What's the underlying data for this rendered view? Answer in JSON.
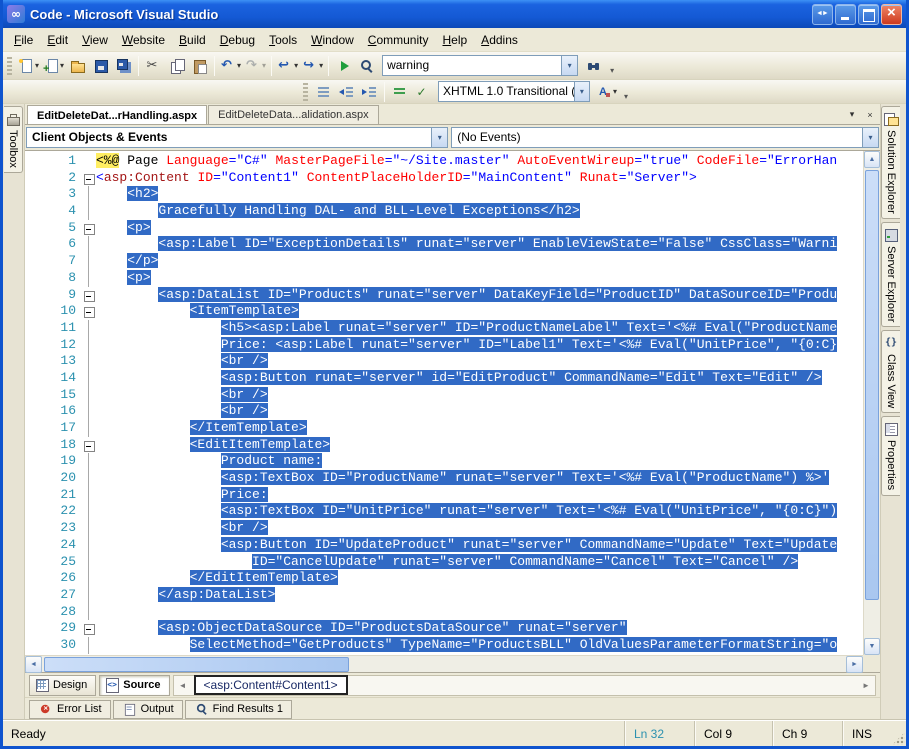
{
  "window": {
    "title": "Code - Microsoft Visual Studio",
    "app_initial": "∞",
    "controls": [
      {
        "name": "dock-arrows"
      },
      {
        "name": "minimize"
      },
      {
        "name": "maximize"
      },
      {
        "name": "close"
      }
    ]
  },
  "glyphs": {
    "dropdown": "▾",
    "close": "×",
    "scroll_left": "◄",
    "scroll_right": "►",
    "scroll_up": "▲",
    "scroll_down": "▼",
    "nav_back": "◄",
    "nav_forward": "►"
  },
  "menu": [
    "File",
    "Edit",
    "View",
    "Website",
    "Build",
    "Debug",
    "Tools",
    "Window",
    "Community",
    "Help",
    "Addins"
  ],
  "toolbar_standard": {
    "buttons": [
      {
        "icon": "new-website",
        "dropdown": true
      },
      {
        "icon": "add-item",
        "dropdown": true
      },
      {
        "icon": "open-file"
      },
      {
        "icon": "save"
      },
      {
        "icon": "save-all"
      },
      {
        "sep": true
      },
      {
        "icon": "cut"
      },
      {
        "icon": "copy"
      },
      {
        "icon": "paste"
      },
      {
        "sep": true
      },
      {
        "icon": "undo",
        "dropdown": true
      },
      {
        "icon": "redo",
        "dropdown": true,
        "disabled": true
      },
      {
        "sep": true
      },
      {
        "icon": "nav-backward",
        "dropdown": true
      },
      {
        "icon": "nav-forward",
        "dropdown": true
      },
      {
        "sep": true
      },
      {
        "icon": "start-debug"
      },
      {
        "icon": "find-in-files"
      },
      {
        "combo": "warning",
        "name": "find-combo"
      },
      {
        "icon": "find-symbol"
      },
      {
        "overflow": true
      }
    ]
  },
  "toolbar_html_source": {
    "buttons": [
      {
        "icon": "format-document"
      },
      {
        "icon": "decrease-indent"
      },
      {
        "icon": "increase-indent"
      },
      {
        "sep": true
      },
      {
        "icon": "comment"
      },
      {
        "icon": "task-list"
      },
      {
        "combo": "XHTML 1.0 Transitional (",
        "name": "schema-combo"
      },
      {
        "icon": "style-application",
        "dropdown": true
      },
      {
        "overflow": true
      }
    ]
  },
  "document_tabs": [
    {
      "label": "EditDeleteDat...rHandling.aspx",
      "active": true
    },
    {
      "label": "EditDeleteData...alidation.aspx",
      "active": false
    }
  ],
  "navigation_bar": {
    "left": "Client Objects & Events",
    "right": "(No Events)"
  },
  "editor": {
    "lines": [
      {
        "n": 1,
        "fold": "",
        "tokens": [
          [
            "dir",
            "<%@"
          ],
          [
            "pl",
            " Page "
          ],
          [
            "at",
            "Language"
          ],
          [
            "vl",
            "=\"C#\""
          ],
          [
            "pl",
            " "
          ],
          [
            "at",
            "MasterPageFile"
          ],
          [
            "vl",
            "=\"~/Site.master\""
          ],
          [
            "pl",
            " "
          ],
          [
            "at",
            "AutoEventWireup"
          ],
          [
            "vl",
            "=\"true\""
          ],
          [
            "pl",
            " "
          ],
          [
            "at",
            "CodeFile"
          ],
          [
            "vl",
            "=\"ErrorHan"
          ]
        ]
      },
      {
        "n": 2,
        "fold": "box",
        "tokens": [
          [
            "dl",
            "<"
          ],
          [
            "tag",
            "asp:Content"
          ],
          [
            "pl",
            " "
          ],
          [
            "at",
            "ID"
          ],
          [
            "vl",
            "=\"Content1\""
          ],
          [
            "pl",
            " "
          ],
          [
            "at",
            "ContentPlaceHolderID"
          ],
          [
            "vl",
            "=\"MainContent\""
          ],
          [
            "pl",
            " "
          ],
          [
            "at",
            "Runat"
          ],
          [
            "vl",
            "=\"Server\""
          ],
          [
            "dl",
            ">"
          ]
        ]
      },
      {
        "n": 3,
        "fold": "line",
        "indent": "    ",
        "sel": "<h2>"
      },
      {
        "n": 4,
        "fold": "line",
        "indent": "        ",
        "sel": "Gracefully Handling DAL- and BLL-Level Exceptions</h2>"
      },
      {
        "n": 5,
        "fold": "box",
        "indent": "    ",
        "sel": "<p>"
      },
      {
        "n": 6,
        "fold": "line",
        "indent": "        ",
        "sel": "<asp:Label ID=\"ExceptionDetails\" runat=\"server\" EnableViewState=\"False\" CssClass=\"Warni"
      },
      {
        "n": 7,
        "fold": "line",
        "indent": "    ",
        "sel": "</p>"
      },
      {
        "n": 8,
        "fold": "line",
        "indent": "    ",
        "sel": "<p>"
      },
      {
        "n": 9,
        "fold": "box",
        "indent": "        ",
        "sel": "<asp:DataList ID=\"Products\" runat=\"server\" DataKeyField=\"ProductID\" DataSourceID=\"Produ"
      },
      {
        "n": 10,
        "fold": "box",
        "indent": "            ",
        "sel": "<ItemTemplate>"
      },
      {
        "n": 11,
        "fold": "line",
        "indent": "                ",
        "sel": "<h5><asp:Label runat=\"server\" ID=\"ProductNameLabel\" Text='<%# Eval(\"ProductName"
      },
      {
        "n": 12,
        "fold": "line",
        "indent": "                ",
        "sel": "Price: <asp:Label runat=\"server\" ID=\"Label1\" Text='<%# Eval(\"UnitPrice\", \"{0:C}"
      },
      {
        "n": 13,
        "fold": "line",
        "indent": "                ",
        "sel": "<br />"
      },
      {
        "n": 14,
        "fold": "line",
        "indent": "                ",
        "sel": "<asp:Button runat=\"server\" id=\"EditProduct\" CommandName=\"Edit\" Text=\"Edit\" />"
      },
      {
        "n": 15,
        "fold": "line",
        "indent": "                ",
        "sel": "<br />"
      },
      {
        "n": 16,
        "fold": "line",
        "indent": "                ",
        "sel": "<br />"
      },
      {
        "n": 17,
        "fold": "line",
        "indent": "            ",
        "sel": "</ItemTemplate>"
      },
      {
        "n": 18,
        "fold": "box",
        "indent": "            ",
        "sel": "<EditItemTemplate>"
      },
      {
        "n": 19,
        "fold": "line",
        "indent": "                ",
        "sel": "Product name:"
      },
      {
        "n": 20,
        "fold": "line",
        "indent": "                ",
        "sel": "<asp:TextBox ID=\"ProductName\" runat=\"server\" Text='<%# Eval(\"ProductName\") %>'"
      },
      {
        "n": 21,
        "fold": "line",
        "indent": "                ",
        "sel": "Price:"
      },
      {
        "n": 22,
        "fold": "line",
        "indent": "                ",
        "sel": "<asp:TextBox ID=\"UnitPrice\" runat=\"server\" Text='<%# Eval(\"UnitPrice\", \"{0:C}\")"
      },
      {
        "n": 23,
        "fold": "line",
        "indent": "                ",
        "sel": "<br />"
      },
      {
        "n": 24,
        "fold": "line",
        "indent": "                ",
        "sel": "<asp:Button ID=\"UpdateProduct\" runat=\"server\" CommandName=\"Update\" Text=\"Update"
      },
      {
        "n": 25,
        "fold": "line",
        "indent": "                    ",
        "sel": "ID=\"CancelUpdate\" runat=\"server\" CommandName=\"Cancel\" Text=\"Cancel\" />"
      },
      {
        "n": 26,
        "fold": "line",
        "indent": "            ",
        "sel": "</EditItemTemplate>"
      },
      {
        "n": 27,
        "fold": "line",
        "indent": "        ",
        "sel": "</asp:DataList>"
      },
      {
        "n": 28,
        "fold": "line",
        "indent": "",
        "sel": ""
      },
      {
        "n": 29,
        "fold": "box",
        "indent": "        ",
        "sel": "<asp:ObjectDataSource ID=\"ProductsDataSource\" runat=\"server\""
      },
      {
        "n": 30,
        "fold": "line",
        "indent": "            ",
        "sel": "SelectMethod=\"GetProducts\" TypeName=\"ProductsBLL\" OldValuesParameterFormatString=\"o"
      }
    ]
  },
  "view_bar": {
    "design": "Design",
    "source": "Source",
    "tag": "<asp:Content#Content1>"
  },
  "bottom_tabs": [
    {
      "icon": "error-list",
      "label": "Error List"
    },
    {
      "icon": "output",
      "label": "Output"
    },
    {
      "icon": "find-results",
      "label": "Find Results 1"
    }
  ],
  "left_dock": [
    {
      "icon": "toolbox",
      "label": "Toolbox"
    }
  ],
  "right_dock": [
    {
      "icon": "solution-explorer",
      "label": "Solution Explorer"
    },
    {
      "icon": "server-explorer",
      "label": "Server Explorer"
    },
    {
      "icon": "class-view",
      "label": "Class View"
    },
    {
      "icon": "properties",
      "label": "Properties"
    }
  ],
  "status_bar": {
    "message": "Ready",
    "line": "Ln 32",
    "column": "Col 9",
    "character": "Ch 9",
    "mode": "INS"
  },
  "colors": {
    "selection": "#316AC5",
    "line_number": "#2B91AF",
    "tag_name": "#A31515",
    "attribute": "#FF0000",
    "value": "#0000FF",
    "directive_bg": "#FFEE62",
    "title_bar": "#1459D4"
  }
}
